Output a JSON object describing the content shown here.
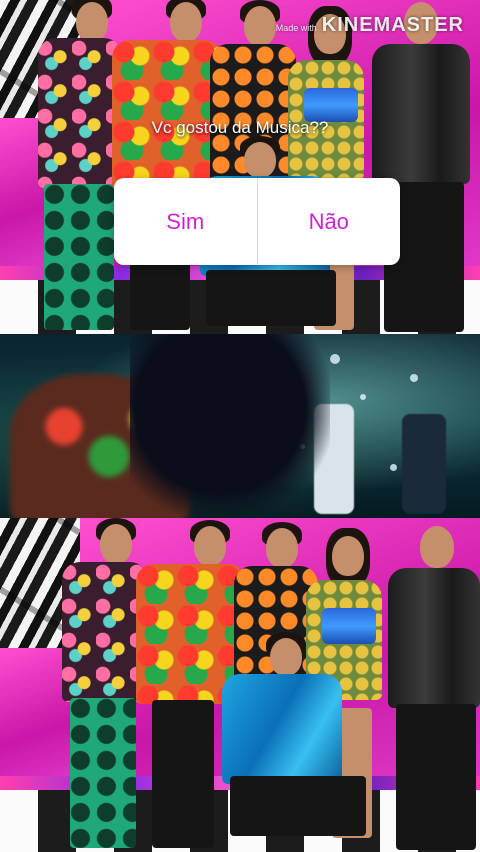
{
  "watermark": {
    "prefix": "Made with",
    "brand": "KINEMASTER"
  },
  "poll": {
    "question": "Vc gostou da Musica??",
    "options": [
      {
        "label": "Sim"
      },
      {
        "label": "Não"
      }
    ],
    "accent_color": "#d21fd6"
  },
  "media": {
    "top_photo": "group-photo",
    "middle_clip": "music-video-frame",
    "bottom_photo": "group-photo"
  }
}
